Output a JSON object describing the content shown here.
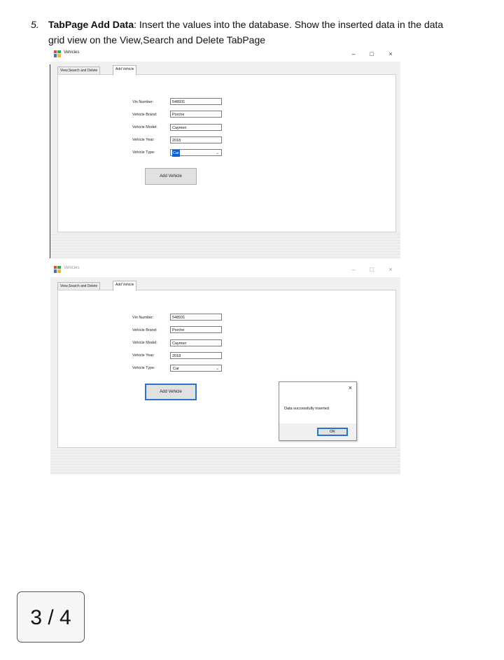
{
  "heading": {
    "number": "5.",
    "bold_label": "TabPage Add Data",
    "text_line1": ": Insert the values into the database. Show the inserted data in the data",
    "text_line2": "grid view on the View,Search and Delete TabPage"
  },
  "window_controls": {
    "minimize": "–",
    "maximize": "□",
    "close": "×"
  },
  "window1": {
    "title": "Vehicles",
    "tabs": [
      "View,Search and Delete",
      "Add Vehicle"
    ],
    "active_tab": "Add Vehicle",
    "form": {
      "vin_label": "Vin Number:",
      "vin_value": "548931",
      "brand_label": "Vehicle Brand:",
      "brand_value": "Porche",
      "model_label": "Vehicle Model:",
      "model_value": "Caymen",
      "year_label": "Vehicle Year:",
      "year_value": "2018",
      "type_label": "Vehicle Type:",
      "type_value": "Car"
    },
    "add_button": "Add Vehicle"
  },
  "window2": {
    "title": "Vehicles",
    "tabs": [
      "View,Search and Delete",
      "Add Vehicle"
    ],
    "active_tab": "Add Vehicle",
    "form": {
      "vin_label": "Vin Number:",
      "vin_value": "548931",
      "brand_label": "Vehicle Brand:",
      "brand_value": "Porche",
      "model_label": "Vehicle Model:",
      "model_value": "Caymen",
      "year_label": "Vehicle Year:",
      "year_value": "2018",
      "type_label": "Vehicle Type:",
      "type_value": "Car"
    },
    "add_button": "Add Vehicle"
  },
  "message_box": {
    "close": "×",
    "message": "Data successfully inserted",
    "ok_button": "OK"
  },
  "pager": {
    "label": "3 / 4"
  },
  "colors": {
    "selection": "#0a5fd4",
    "default_button_border": "#2a73cc"
  }
}
